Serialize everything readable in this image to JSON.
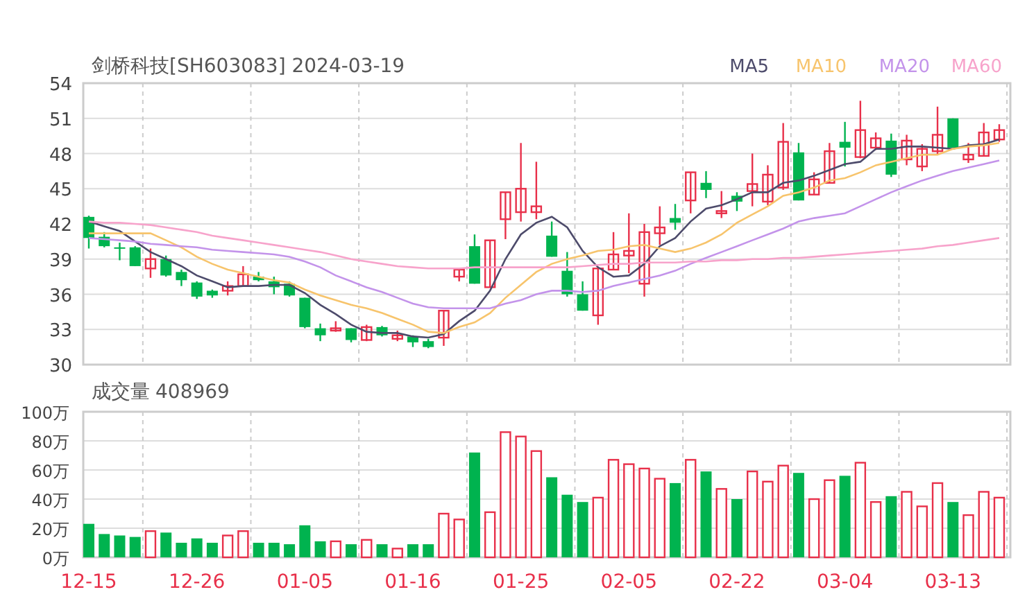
{
  "header": {
    "title": "剑桥科技[SH603083] 2024-03-19"
  },
  "price_chart": {
    "candles": {
      "chart_data": {
        "type": "candlestick",
        "grid": true,
        "ylim": [
          30,
          54
        ],
        "yticks": [
          30,
          33,
          36,
          39,
          42,
          45,
          48,
          51,
          54
        ],
        "categories": [
          null,
          null,
          null,
          null,
          null,
          null,
          null,
          null,
          null,
          null,
          null,
          null,
          null,
          null,
          null,
          null,
          null,
          null,
          null,
          null,
          null,
          null,
          null,
          null,
          null,
          null,
          null,
          null,
          null,
          null,
          null,
          null,
          null,
          null,
          null,
          null,
          null,
          null,
          null,
          null,
          null,
          null,
          null,
          null,
          null,
          null,
          null,
          null,
          null,
          null,
          null,
          null,
          null,
          null,
          null,
          null,
          null,
          null,
          null,
          null
        ],
        "ohlc": [
          [
            42.6,
            42.7,
            39.9,
            40.8
          ],
          [
            40.9,
            41.3,
            40.0,
            40.1
          ],
          [
            40.0,
            40.4,
            38.9,
            39.9
          ],
          [
            40.0,
            40.1,
            38.4,
            38.4
          ],
          [
            38.2,
            39.9,
            37.4,
            39.0
          ],
          [
            39.0,
            39.3,
            37.5,
            37.6
          ],
          [
            37.9,
            38.1,
            36.7,
            37.2
          ],
          [
            37.0,
            37.1,
            35.6,
            35.8
          ],
          [
            36.3,
            36.4,
            35.7,
            35.9
          ],
          [
            36.3,
            37.1,
            35.9,
            36.7
          ],
          [
            36.7,
            38.4,
            36.7,
            37.7
          ],
          [
            37.5,
            37.9,
            37.1,
            37.2
          ],
          [
            37.1,
            37.5,
            36.0,
            36.6
          ],
          [
            36.9,
            37.1,
            35.8,
            35.9
          ],
          [
            35.7,
            35.7,
            33.1,
            33.2
          ],
          [
            33.1,
            33.5,
            32.0,
            32.5
          ],
          [
            32.9,
            33.7,
            32.8,
            33.1
          ],
          [
            33.1,
            33.1,
            31.9,
            32.1
          ],
          [
            32.1,
            33.4,
            32.0,
            33.2
          ],
          [
            33.2,
            33.3,
            32.4,
            32.5
          ],
          [
            32.2,
            32.9,
            32.0,
            32.5
          ],
          [
            32.4,
            32.5,
            31.5,
            31.9
          ],
          [
            32.0,
            32.2,
            31.4,
            31.5
          ],
          [
            32.3,
            34.6,
            31.6,
            34.6
          ],
          [
            37.5,
            38.2,
            37.1,
            38.1
          ],
          [
            40.1,
            41.1,
            36.9,
            36.9
          ],
          [
            36.6,
            40.6,
            36.6,
            40.6
          ],
          [
            42.4,
            44.7,
            40.7,
            44.7
          ],
          [
            43.0,
            48.9,
            42.2,
            45.0
          ],
          [
            43.0,
            47.3,
            42.4,
            43.5
          ],
          [
            41.0,
            42.2,
            39.2,
            39.2
          ],
          [
            38.0,
            39.6,
            35.8,
            36.0
          ],
          [
            36.0,
            37.1,
            34.6,
            34.6
          ],
          [
            34.2,
            38.2,
            33.4,
            38.2
          ],
          [
            38.1,
            41.3,
            38.1,
            39.4
          ],
          [
            39.3,
            42.9,
            37.8,
            39.7
          ],
          [
            36.9,
            42.0,
            35.8,
            41.3
          ],
          [
            41.2,
            43.5,
            40.2,
            41.7
          ],
          [
            42.5,
            43.7,
            41.5,
            42.1
          ],
          [
            44.0,
            46.4,
            42.9,
            46.4
          ],
          [
            45.5,
            46.5,
            44.2,
            44.9
          ],
          [
            42.9,
            44.8,
            42.5,
            43.1
          ],
          [
            44.4,
            44.7,
            43.1,
            43.9
          ],
          [
            44.8,
            48.0,
            43.5,
            45.4
          ],
          [
            43.9,
            47.0,
            43.6,
            46.2
          ],
          [
            45.1,
            50.6,
            44.9,
            49.0
          ],
          [
            48.1,
            48.9,
            44.0,
            44.0
          ],
          [
            44.5,
            46.4,
            44.5,
            45.8
          ],
          [
            45.5,
            48.9,
            45.5,
            48.2
          ],
          [
            49.0,
            50.7,
            46.9,
            48.5
          ],
          [
            47.7,
            52.5,
            47.6,
            50.0
          ],
          [
            48.5,
            49.8,
            48.3,
            49.3
          ],
          [
            49.1,
            49.7,
            46.0,
            46.2
          ],
          [
            47.5,
            49.6,
            47.0,
            49.1
          ],
          [
            46.9,
            48.8,
            46.5,
            48.4
          ],
          [
            48.2,
            52.0,
            47.9,
            49.6
          ],
          [
            51.0,
            51.0,
            48.5,
            48.5
          ],
          [
            47.5,
            48.9,
            47.2,
            47.9
          ],
          [
            47.8,
            50.6,
            47.8,
            49.8
          ],
          [
            49.2,
            50.5,
            49.0,
            50.0
          ]
        ]
      }
    },
    "moving_averages": {
      "chart_data": {
        "type": "line",
        "ylim": [
          30,
          54
        ],
        "series": [
          {
            "name": "MA5",
            "color": "#4d4b6b",
            "values": [
              42.2,
              41.8,
              41.4,
              40.5,
              39.6,
              39.0,
              38.4,
              37.6,
              37.1,
              36.6,
              36.7,
              36.7,
              36.8,
              36.8,
              36.1,
              35.1,
              34.3,
              33.4,
              32.8,
              32.7,
              32.7,
              32.4,
              32.3,
              32.6,
              33.7,
              34.6,
              36.3,
              39.0,
              41.1,
              42.1,
              42.6,
              41.7,
              39.7,
              38.3,
              37.5,
              37.6,
              38.6,
              40.1,
              40.8,
              42.2,
              43.3,
              43.6,
              44.1,
              44.7,
              44.7,
              45.5,
              45.7,
              46.1,
              46.6,
              47.1,
              47.3,
              48.4,
              48.4,
              48.6,
              48.6,
              48.5,
              48.4,
              48.7,
              48.8,
              49.2
            ]
          },
          {
            "name": "MA10",
            "color": "#f7c46c",
            "values": [
              41.2,
              41.2,
              41.2,
              41.2,
              41.2,
              40.6,
              40.0,
              39.2,
              38.6,
              38.1,
              37.8,
              37.5,
              37.2,
              37.0,
              36.4,
              35.9,
              35.5,
              35.1,
              34.8,
              34.4,
              33.9,
              33.4,
              32.8,
              32.7,
              33.2,
              33.6,
              34.4,
              35.7,
              36.8,
              37.9,
              38.6,
              39.0,
              39.3,
              39.7,
              39.8,
              40.1,
              40.2,
              39.9,
              39.6,
              39.9,
              40.4,
              41.1,
              42.1,
              42.8,
              43.5,
              44.4,
              44.7,
              45.1,
              45.7,
              45.9,
              46.4,
              47.0,
              47.3,
              47.6,
              47.9,
              47.9,
              48.4,
              48.6,
              48.7,
              48.9
            ]
          },
          {
            "name": "MA20",
            "color": "#c393ea",
            "values": [
              40.8,
              40.7,
              40.6,
              40.5,
              40.3,
              40.2,
              40.1,
              40.0,
              39.8,
              39.7,
              39.6,
              39.5,
              39.4,
              39.2,
              38.8,
              38.3,
              37.6,
              37.1,
              36.6,
              36.2,
              35.7,
              35.2,
              34.9,
              34.8,
              34.8,
              34.8,
              34.8,
              35.2,
              35.5,
              36.0,
              36.3,
              36.3,
              36.2,
              36.3,
              36.7,
              37.0,
              37.3,
              37.6,
              38.0,
              38.6,
              39.1,
              39.6,
              40.1,
              40.6,
              41.1,
              41.6,
              42.2,
              42.5,
              42.7,
              42.9,
              43.5,
              44.1,
              44.7,
              45.2,
              45.7,
              46.1,
              46.5,
              46.8,
              47.1,
              47.4
            ]
          },
          {
            "name": "MA60",
            "color": "#f7a3cb",
            "values": [
              42.2,
              42.1,
              42.1,
              42.0,
              41.9,
              41.7,
              41.5,
              41.3,
              41.0,
              40.8,
              40.6,
              40.4,
              40.2,
              40.0,
              39.8,
              39.6,
              39.3,
              39.0,
              38.8,
              38.6,
              38.4,
              38.3,
              38.2,
              38.2,
              38.2,
              38.3,
              38.3,
              38.3,
              38.3,
              38.3,
              38.3,
              38.3,
              38.4,
              38.5,
              38.6,
              38.6,
              38.7,
              38.7,
              38.7,
              38.8,
              38.8,
              38.9,
              38.9,
              39.0,
              39.0,
              39.1,
              39.1,
              39.2,
              39.3,
              39.4,
              39.5,
              39.6,
              39.7,
              39.8,
              39.9,
              40.1,
              40.2,
              40.4,
              40.6,
              40.8
            ]
          }
        ]
      }
    }
  },
  "volume_panel": {
    "label": "成交量",
    "value": "408969",
    "chart_data": {
      "type": "bar",
      "grid": true,
      "ylim": [
        0,
        100
      ],
      "yticks": [
        {
          "value": 0,
          "label": "0万"
        },
        {
          "value": 20,
          "label": "20万"
        },
        {
          "value": 40,
          "label": "40万"
        },
        {
          "value": 60,
          "label": "60万"
        },
        {
          "value": 80,
          "label": "80万"
        },
        {
          "value": 100,
          "label": "100万"
        }
      ],
      "categories": [
        "12-15",
        null,
        null,
        null,
        null,
        null,
        null,
        "12-26",
        null,
        null,
        null,
        null,
        null,
        null,
        "01-05",
        null,
        null,
        null,
        null,
        null,
        null,
        "01-16",
        null,
        null,
        null,
        null,
        null,
        null,
        "01-25",
        null,
        null,
        null,
        null,
        null,
        null,
        "02-05",
        null,
        null,
        null,
        null,
        null,
        null,
        "02-22",
        null,
        null,
        null,
        null,
        null,
        null,
        "03-04",
        null,
        null,
        null,
        null,
        null,
        null,
        "03-13",
        null,
        null,
        null
      ],
      "values": [
        23,
        16,
        15,
        14,
        18,
        17,
        10,
        13,
        10,
        15,
        18,
        10,
        10,
        9,
        22,
        11,
        11,
        9,
        12,
        9,
        6,
        9,
        9,
        30,
        26,
        72,
        31,
        86,
        83,
        73,
        55,
        43,
        38,
        41,
        67,
        64,
        61,
        54,
        51,
        67,
        59,
        47,
        40,
        59,
        52,
        63,
        58,
        40,
        53,
        56,
        65,
        38,
        42,
        45,
        35,
        51,
        38,
        29,
        45,
        41
      ]
    }
  }
}
